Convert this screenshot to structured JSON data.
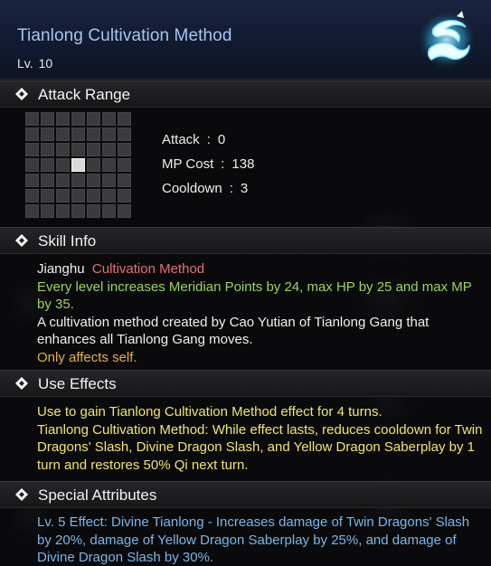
{
  "skill": {
    "title": "Tianlong Cultivation Method",
    "level_label": "Lv.",
    "level_value": "10",
    "icon": "dragon-emblem-icon"
  },
  "sections": {
    "attack_range": "Attack Range",
    "skill_info": "Skill Info",
    "use_effects": "Use Effects",
    "special_attributes": "Special Attributes"
  },
  "attack_range": {
    "grid_rows": 7,
    "grid_cols": 7,
    "self_cell": [
      3,
      3
    ],
    "stats": [
      {
        "label": "Attack",
        "value": "0",
        "sep": ":"
      },
      {
        "label": "MP Cost",
        "value": "138",
        "sep": ":"
      },
      {
        "label": "Cooldown",
        "value": "3",
        "sep": ":"
      }
    ]
  },
  "skill_info": {
    "category": "Jianghu",
    "type": "Cultivation Method",
    "level_bonus": "Every level increases Meridian Points by 24, max HP by 25 and max MP by 35.",
    "description": "A cultivation method created by Cao Yutian of Tianlong Gang that enhances all Tianlong Gang moves.",
    "target": "Only affects self."
  },
  "use_effects": {
    "line1": "Use to gain Tianlong Cultivation Method effect for 4 turns.",
    "line2": "Tianlong Cultivation Method: While effect lasts, reduces cooldown for Twin Dragons' Slash, Divine Dragon Slash, and Yellow Dragon Saberplay by 1 turn and restores 50% Qi next turn."
  },
  "special_attributes": {
    "line1": "Lv. 5 Effect: Divine Tianlong - Increases damage of Twin Dragons' Slash by 20%, damage of Yellow Dragon Saberplay by 25%, and damage of Divine Dragon Slash by 30%."
  },
  "colors": {
    "title": "#a9c4ee",
    "skill_type": "#e66f78",
    "level_bonus": "#9fd25a",
    "target": "#e6b040",
    "use_effects": "#f2e56a",
    "special_attributes": "#7ab6e8"
  }
}
